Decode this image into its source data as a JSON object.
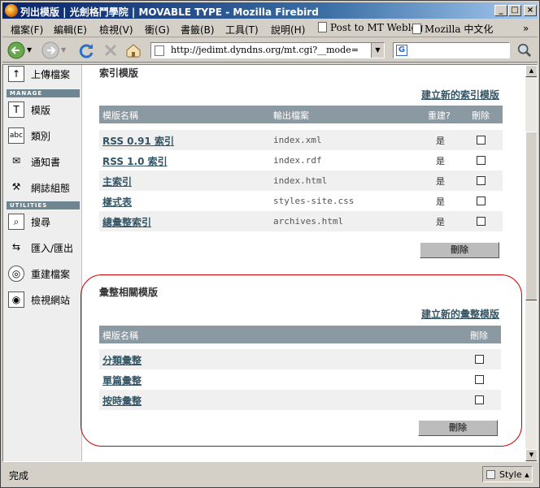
{
  "window": {
    "title": "列出模版 | 光劍格鬥學院 | MOVABLE TYPE - Mozilla Firebird",
    "minimize": "_",
    "maximize": "□",
    "close": "×"
  },
  "menu": {
    "items": [
      "檔案(F)",
      "編輯(E)",
      "檢視(V)",
      "衝(G)",
      "書籤(B)",
      "工具(T)",
      "說明(H)"
    ],
    "bookmarks": [
      "Post to MT Weblog",
      "Mozilla 中文化"
    ],
    "overflow": "»"
  },
  "nav": {
    "url": "http://jedimt.dyndns.org/mt.cgi?__mode=list&_type=",
    "search_value": ""
  },
  "sidebar": {
    "upload_label": "上傳檔案",
    "manage_header": "MANAGE",
    "templates_label": "模版",
    "categories_label": "類別",
    "notifications_label": "通知書",
    "config_label": "網誌組態",
    "utilities_header": "UTILITIES",
    "search_label": "搜尋",
    "import_label": "匯入/匯出",
    "rebuild_label": "重建檔案",
    "view_site_label": "檢視網站"
  },
  "index_section": {
    "title": "索引模版",
    "create_link": "建立新的索引模版",
    "columns": [
      "模版名稱",
      "輸出檔案",
      "重建?",
      "刪除"
    ],
    "rows": [
      {
        "name": "RSS 0.91 索引",
        "output": "index.xml",
        "rebuild": "是"
      },
      {
        "name": "RSS 1.0 索引",
        "output": "index.rdf",
        "rebuild": "是"
      },
      {
        "name": "主索引",
        "output": "index.html",
        "rebuild": "是"
      },
      {
        "name": "樣式表",
        "output": "styles-site.css",
        "rebuild": "是"
      },
      {
        "name": "總彙整索引",
        "output": "archives.html",
        "rebuild": "是"
      }
    ],
    "delete_button": "刪除"
  },
  "archive_section": {
    "title": "彙整相關模版",
    "create_link": "建立新的彙整模版",
    "columns": [
      "模版名稱",
      "刪除"
    ],
    "rows": [
      {
        "name": "分類彙整"
      },
      {
        "name": "單篇彙整"
      },
      {
        "name": "按時彙整"
      }
    ],
    "delete_button": "刪除"
  },
  "status": {
    "text": "完成",
    "style_label": "Style"
  },
  "colors": {
    "highlight_circle": "#d00000",
    "table_header": "#8b9aa2",
    "link": "#335566"
  }
}
